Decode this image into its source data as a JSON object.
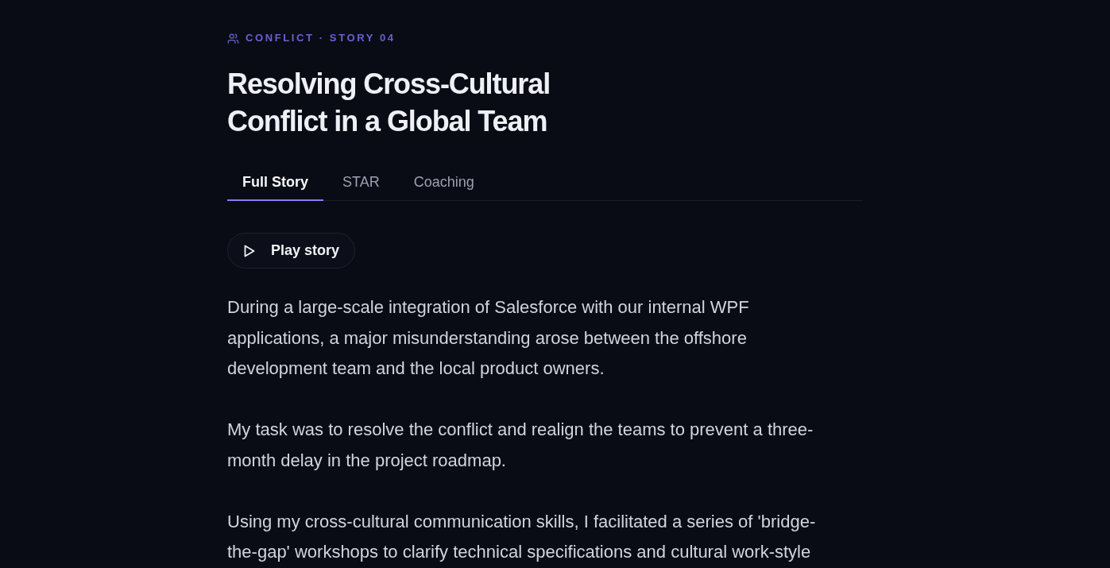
{
  "eyebrow": {
    "label": "CONFLICT · STORY 04"
  },
  "title": "Resolving Cross-Cultural Conflict in a Global Team",
  "tabs": [
    {
      "label": "Full Story",
      "selected": true
    },
    {
      "label": "STAR",
      "selected": false
    },
    {
      "label": "Coaching",
      "selected": false
    }
  ],
  "play_button": {
    "label": "Play story"
  },
  "paragraphs": [
    "During a large-scale integration of Salesforce with our internal WPF applications, a major misunderstanding arose between the offshore development team and the local product owners.",
    "My task was to resolve the conflict and realign the teams to prevent a three-month delay in the project roadmap.",
    "Using my cross-cultural communication skills, I facilitated a series of 'bridge-the-gap' workshops to clarify technical specifications and cultural work-style"
  ]
}
